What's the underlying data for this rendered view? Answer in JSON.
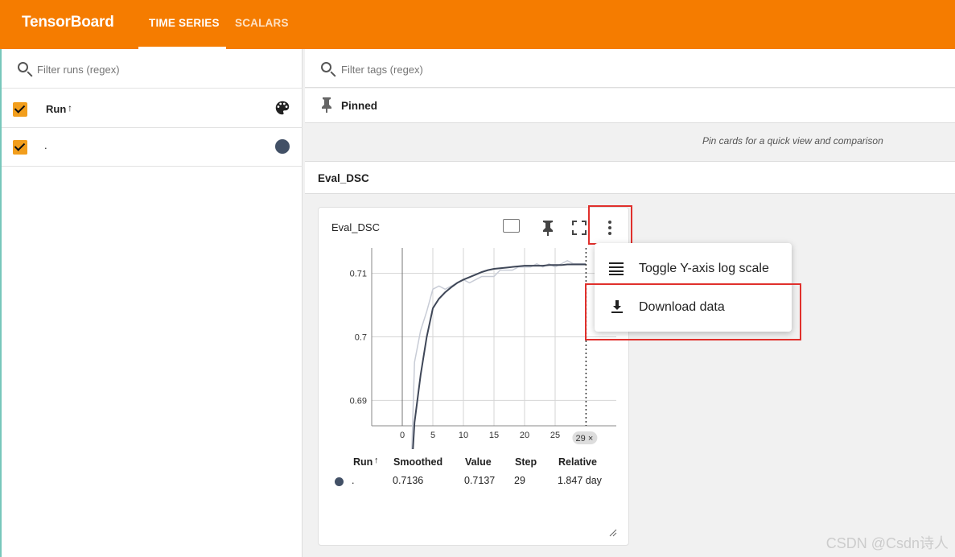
{
  "app": {
    "title": "TensorBoard",
    "tabs": [
      "TIME SERIES",
      "SCALARS"
    ]
  },
  "left": {
    "filter_placeholder": "Filter runs (regex)",
    "header": "Run",
    "sort_indicator": "↑",
    "run_name": "."
  },
  "right": {
    "filter_placeholder": "Filter tags (regex)",
    "pinned_title": "Pinned",
    "pinned_note": "Pin cards for a quick view and comparison",
    "group_title": "Eval_DSC"
  },
  "card": {
    "title": "Eval_DSC",
    "table_headers": [
      "Run",
      "Smoothed",
      "Value",
      "Step",
      "Relative"
    ],
    "table_row": [
      ".",
      "0.7136",
      "0.7137",
      "29",
      "1.847 day"
    ]
  },
  "menu": {
    "items": [
      "Toggle Y-axis log scale",
      "Download data"
    ]
  },
  "footer": "CSDN @Csdn诗人",
  "chart_data": {
    "type": "line",
    "title": "Eval_DSC",
    "xlabel": "",
    "ylabel": "",
    "xlim": [
      -5,
      35
    ],
    "ylim": [
      0.686,
      0.714
    ],
    "x_ticks": [
      "0",
      "5",
      "10",
      "15",
      "20",
      "25"
    ],
    "y_ticks": [
      "0.69",
      "0.7",
      "0.71"
    ],
    "cursor_label": "29",
    "series": [
      {
        "values": [
          [
            1.5,
            0.68
          ],
          [
            2,
            0.696
          ],
          [
            3,
            0.701
          ],
          [
            4,
            0.704
          ],
          [
            5,
            0.7075
          ],
          [
            6,
            0.708
          ],
          [
            7,
            0.7075
          ],
          [
            8,
            0.708
          ],
          [
            9,
            0.7085
          ],
          [
            10,
            0.709
          ],
          [
            11,
            0.7085
          ],
          [
            12,
            0.709
          ],
          [
            13,
            0.7095
          ],
          [
            14,
            0.7095
          ],
          [
            15,
            0.7095
          ],
          [
            16,
            0.7105
          ],
          [
            17,
            0.7105
          ],
          [
            18,
            0.7105
          ],
          [
            19,
            0.711
          ],
          [
            20,
            0.711
          ],
          [
            21,
            0.711
          ],
          [
            22,
            0.7115
          ],
          [
            23,
            0.711
          ],
          [
            24,
            0.7115
          ],
          [
            25,
            0.711
          ],
          [
            26,
            0.7115
          ],
          [
            27,
            0.712
          ],
          [
            28,
            0.7115
          ],
          [
            29,
            0.7115
          ],
          [
            30,
            0.7115
          ]
        ]
      },
      {
        "values": [
          [
            1.6,
            0.68
          ],
          [
            2,
            0.6865
          ],
          [
            3,
            0.694
          ],
          [
            4,
            0.7
          ],
          [
            5,
            0.7045
          ],
          [
            6,
            0.706
          ],
          [
            7,
            0.707
          ],
          [
            8,
            0.7078
          ],
          [
            9,
            0.7085
          ],
          [
            10,
            0.709
          ],
          [
            11,
            0.7094
          ],
          [
            12,
            0.7098
          ],
          [
            13,
            0.7102
          ],
          [
            14,
            0.7105
          ],
          [
            15,
            0.7107
          ],
          [
            16,
            0.7108
          ],
          [
            17,
            0.7109
          ],
          [
            18,
            0.711
          ],
          [
            19,
            0.7111
          ],
          [
            20,
            0.7112
          ],
          [
            21,
            0.7112
          ],
          [
            22,
            0.7112
          ],
          [
            23,
            0.7112
          ],
          [
            24,
            0.7113
          ],
          [
            25,
            0.7113
          ],
          [
            26,
            0.7113
          ],
          [
            27,
            0.7114
          ],
          [
            28,
            0.7114
          ],
          [
            29,
            0.7114
          ],
          [
            30,
            0.7114
          ]
        ]
      }
    ],
    "colors": [
      "#c8ccd6",
      "#3f4758"
    ]
  }
}
